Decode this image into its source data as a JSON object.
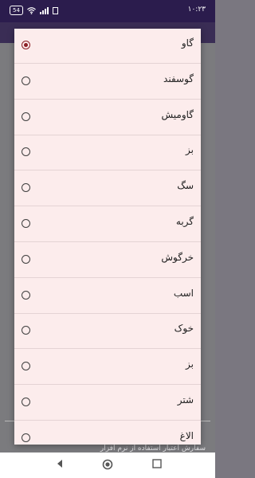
{
  "status_bar": {
    "battery": "54",
    "time": "۱۰:۲۳",
    "icons": [
      "wifi-icon",
      "signal-icon",
      "notification-icon"
    ]
  },
  "background": {
    "footer_text": "سفارش اعتبار استفاده از نرم افزار"
  },
  "dialog": {
    "selected_index": 0,
    "options": [
      {
        "label": "گاو",
        "selected": true
      },
      {
        "label": "گوسفند",
        "selected": false
      },
      {
        "label": "گاومیش",
        "selected": false
      },
      {
        "label": "بز",
        "selected": false
      },
      {
        "label": "سگ",
        "selected": false
      },
      {
        "label": "گربه",
        "selected": false
      },
      {
        "label": "خرگوش",
        "selected": false
      },
      {
        "label": "اسب",
        "selected": false
      },
      {
        "label": "خوک",
        "selected": false
      },
      {
        "label": "بز",
        "selected": false
      },
      {
        "label": "شتر",
        "selected": false
      },
      {
        "label": "الاغ",
        "selected": false
      }
    ]
  },
  "colors": {
    "accent": "#8b1e24",
    "status_bar": "#2b1c4d",
    "dialog_bg": "#fcecec"
  },
  "nav": {
    "buttons": [
      "back-icon",
      "home-icon",
      "recents-icon"
    ]
  }
}
